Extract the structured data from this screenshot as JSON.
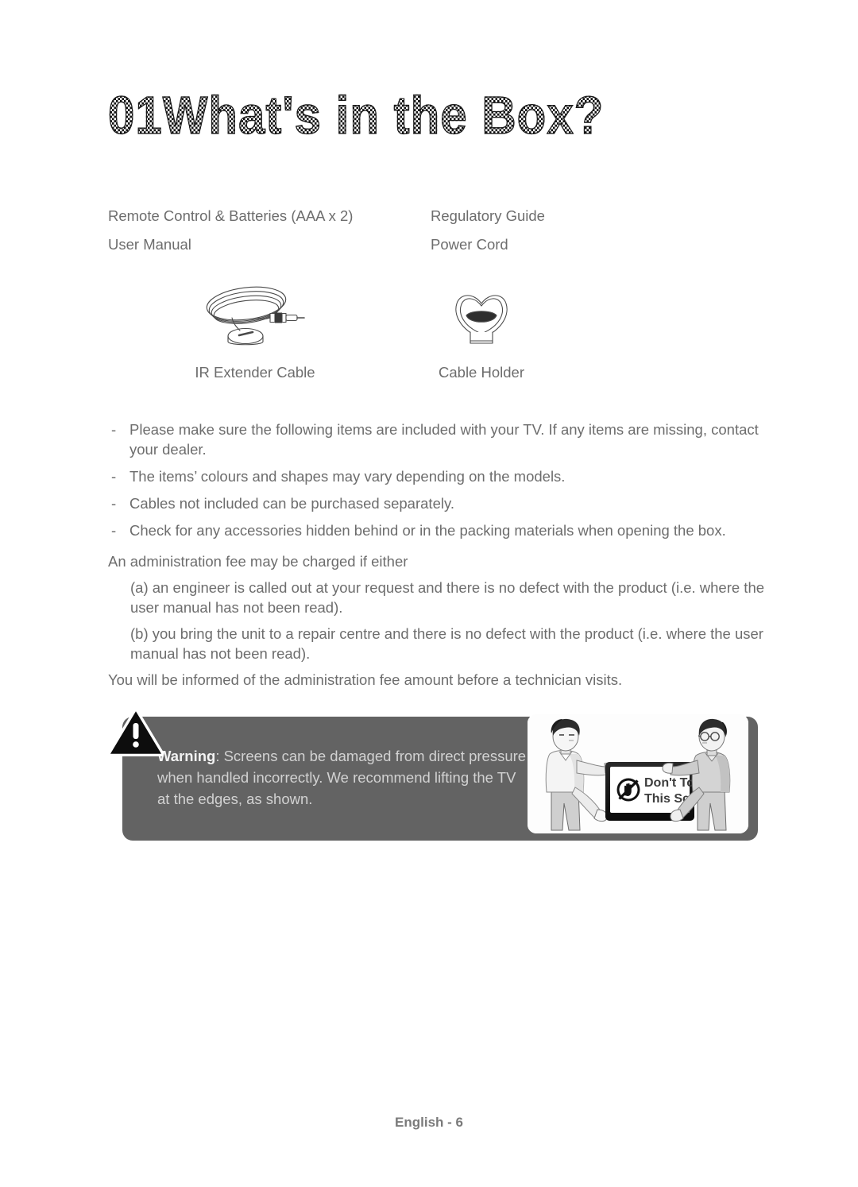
{
  "page": {
    "title": "01What's in the Box?",
    "footer": "English - 6"
  },
  "box_items": {
    "left_column": [
      "Remote Control & Batteries (AAA x 2)",
      "User Manual"
    ],
    "right_column": [
      "Regulatory Guide",
      "Power Cord"
    ]
  },
  "illustrations": [
    {
      "caption": "IR Extender Cable",
      "icon": "ir-extender-cable-icon"
    },
    {
      "caption": "Cable Holder",
      "icon": "cable-holder-icon"
    }
  ],
  "notes": {
    "dash": "-",
    "lines": [
      "Please make sure the following items are included with your TV. If any items are missing, contact your dealer.",
      "The items’ colours and shapes may vary depending on the models.",
      "Cables not included can be purchased separately.",
      "Check for any accessories hidden behind or in the packing materials when opening the box."
    ]
  },
  "admin_fee": {
    "intro": "An administration fee may be charged if either",
    "clause_a": "(a) an engineer is called out at your request and there is no defect with the product (i.e. where the user manual has not been read).",
    "clause_b": "(b) you bring the unit to a repair centre and there is no defect with the product (i.e. where the user manual has not been read).",
    "closing": "You will be informed of the administration fee amount before a technician visits."
  },
  "warning": {
    "label": "Warning",
    "separator": ": ",
    "body": "Screens can be damaged from direct pressure when handled incorrectly. We recommend lifting the TV at the edges, as shown.",
    "illustration": {
      "screen_line_1": "Don't Touch",
      "screen_line_2": "This Screen!",
      "prohibition_icon": "no-hand-icon"
    }
  },
  "colors": {
    "body_text": "#6d6d6d",
    "warning_box_bg": "#636363",
    "warning_body_text": "#d2d2d2",
    "warning_label_text": "#f2f2f2",
    "page_bg": "#ffffff",
    "footer_text": "#7a7a7a"
  }
}
